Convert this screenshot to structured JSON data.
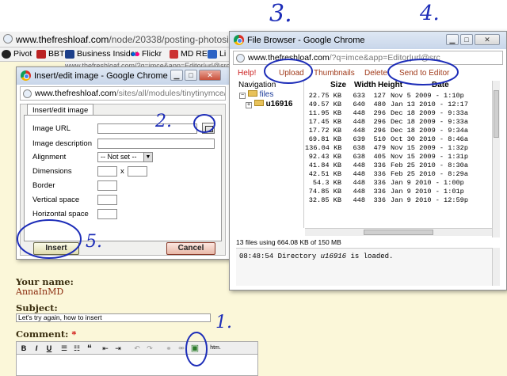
{
  "main_window": {
    "url_host": "www.thefreshloaf.com",
    "url_path": "/node/20338/posting-photosi-kno",
    "background_url": "www.thefreshloaf.com/?q=imce&app=Editor|url@src",
    "bookmarks": [
      {
        "label": "Pivot",
        "icon": "pivot-icon"
      },
      {
        "label": "BBT",
        "icon": "bbt-icon"
      },
      {
        "label": "Business Insider",
        "icon": "bi-icon"
      },
      {
        "label": "Flickr",
        "icon": "flickr-icon"
      },
      {
        "label": "MD RE",
        "icon": "mdre-icon"
      },
      {
        "label": "Li",
        "icon": "li-icon"
      }
    ]
  },
  "annotations": {
    "one": "1.",
    "two": "2.",
    "three": "3.",
    "four": "4.",
    "five": "5."
  },
  "image_dialog": {
    "window_title": "Insert/edit image - Google Chrome",
    "url_host": "www.thefreshloaf.com",
    "url_path": "/sites/all/modules/tinytinymce/tinymc",
    "tab_label": "Insert/edit image",
    "fields": {
      "image_url": "Image URL",
      "image_description": "Image description",
      "alignment": "Alignment",
      "alignment_value": "-- Not set --",
      "dimensions": "Dimensions",
      "dimensions_sep": "x",
      "border": "Border",
      "vertical_space": "Vertical space",
      "horizontal_space": "Horizontal space"
    },
    "insert_label": "Insert",
    "cancel_label": "Cancel"
  },
  "file_browser": {
    "window_title": "File Browser - Google Chrome",
    "url_host": "www.thefreshloaf.com",
    "url_path": "/?q=imce&app=Editor|url@src",
    "toolbar": {
      "help": "Help!",
      "upload": "Upload",
      "thumbnails": "Thumbnails",
      "delete": "Delete",
      "send_to_editor": "Send to Editor"
    },
    "navigation_label": "Navigation",
    "tree_root": "files",
    "tree_child": "u16916",
    "columns": {
      "size": "Size",
      "width": "Width",
      "height": "Height",
      "date": "Date"
    },
    "rows": [
      {
        "size": "22.75 KB",
        "width": "633",
        "height": "127",
        "date": "Nov 5 2009 - 1:10p"
      },
      {
        "size": "49.57 KB",
        "width": "640",
        "height": "480",
        "date": "Jan 13 2010 - 12:17"
      },
      {
        "size": "11.95 KB",
        "width": "448",
        "height": "296",
        "date": "Dec 18 2009 - 9:33a"
      },
      {
        "size": "17.45 KB",
        "width": "448",
        "height": "296",
        "date": "Dec 18 2009 - 9:33a"
      },
      {
        "size": "17.72 KB",
        "width": "448",
        "height": "296",
        "date": "Dec 18 2009 - 9:34a"
      },
      {
        "size": "69.81 KB",
        "width": "639",
        "height": "510",
        "date": "Oct 30 2010 - 8:46a"
      },
      {
        "size": "136.04 KB",
        "width": "638",
        "height": "479",
        "date": "Nov 15 2009 - 1:32p"
      },
      {
        "size": "92.43 KB",
        "width": "638",
        "height": "405",
        "date": "Nov 15 2009 - 1:31p"
      },
      {
        "size": "41.84 KB",
        "width": "448",
        "height": "336",
        "date": "Feb 25 2010 - 8:30a"
      },
      {
        "size": "42.51 KB",
        "width": "448",
        "height": "336",
        "date": "Feb 25 2010 - 8:29a"
      },
      {
        "size": "54.3 KB",
        "width": "448",
        "height": "336",
        "date": "Jan 9 2010 - 1:00p"
      },
      {
        "size": "74.85 KB",
        "width": "448",
        "height": "336",
        "date": "Jan 9 2010 - 1:01p"
      },
      {
        "size": "32.85 KB",
        "width": "448",
        "height": "336",
        "date": "Jan 9 2010 - 12:59p"
      }
    ],
    "file_count": "13 files using 664.08 KB of 150 MB",
    "log_time": "08:48:54",
    "log_msg_pre": "Directory",
    "log_dir": "u16916",
    "log_msg_post": "is loaded."
  },
  "form": {
    "name_label": "Your name:",
    "name_value": "AnnaInMD",
    "subject_label": "Subject:",
    "subject_value": "Let's try again, how to insert",
    "comment_label": "Comment:",
    "required_mark": "*",
    "toolbar_buttons": [
      {
        "text": "B",
        "name": "bold-button"
      },
      {
        "text": "I",
        "name": "italic-button"
      },
      {
        "text": "U",
        "name": "underline-button"
      },
      {
        "text": "☰",
        "name": "bullet-list-button"
      },
      {
        "text": "☷",
        "name": "numbered-list-button"
      },
      {
        "text": "“",
        "name": "blockquote-button"
      },
      {
        "text": "⇤",
        "name": "outdent-button"
      },
      {
        "text": "⇥",
        "name": "indent-button"
      },
      {
        "text": "↶",
        "name": "undo-button"
      },
      {
        "text": "↷",
        "name": "redo-button"
      },
      {
        "text": "⚭",
        "name": "link-button"
      },
      {
        "text": "⚮",
        "name": "unlink-button"
      },
      {
        "text": "▣",
        "name": "insert-image-button"
      },
      {
        "text": "htm.",
        "name": "html-button"
      }
    ]
  }
}
